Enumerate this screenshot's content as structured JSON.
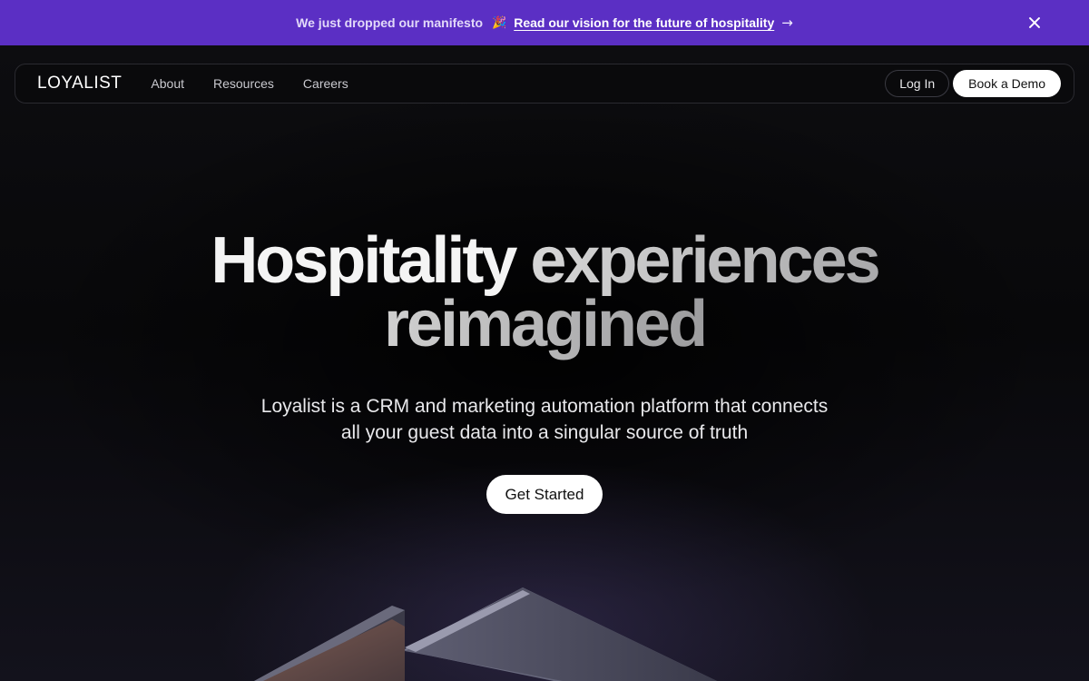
{
  "banner": {
    "message": "We just dropped our manifesto",
    "emoji": "🎉",
    "link_text": "Read our vision for the future of hospitality",
    "arrow": "→"
  },
  "nav": {
    "logo": "LOYALIST",
    "links": [
      "About",
      "Resources",
      "Careers"
    ],
    "login_label": "Log In",
    "demo_label": "Book a Demo"
  },
  "hero": {
    "title_part1": "Hospitality",
    "title_part2": "experiences",
    "title_part3": "reimagined",
    "subtitle_line1": "Loyalist is a CRM and marketing automation platform that connects",
    "subtitle_line2": "all your guest data into a singular source of truth",
    "cta_label": "Get Started"
  },
  "colors": {
    "banner_bg": "#5b2fc4",
    "page_bg": "#0c0b12",
    "button_bg": "#ffffff"
  }
}
